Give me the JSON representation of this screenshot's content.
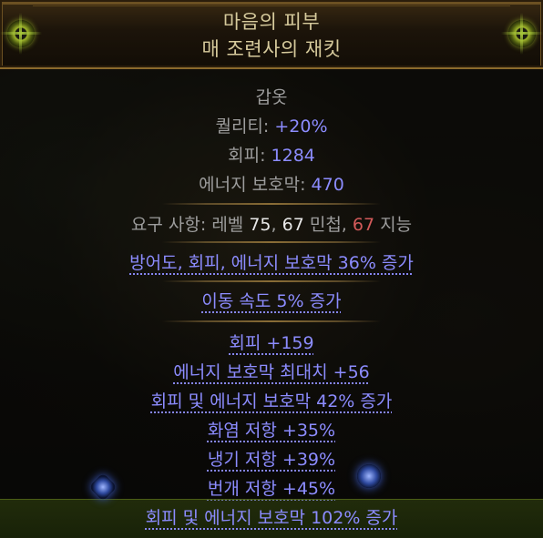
{
  "item": {
    "name": "마음의 피부",
    "base": "매 조련사의 재킷",
    "item_class": "갑옷",
    "properties": [
      {
        "label": "퀄리티: ",
        "value": "+20%"
      },
      {
        "label": "회피: ",
        "value": "1284"
      },
      {
        "label": "에너지 보호막: ",
        "value": "470"
      }
    ],
    "requirements": {
      "prefix": "요구 사항: ",
      "level_label": "레벨",
      "level": " 75",
      "sep1": ", ",
      "dex": "67",
      "dex_label": " 민첩",
      "sep2": ", ",
      "int": "67",
      "int_label": " 지능"
    },
    "implicit": "방어도, 회피, 에너지 보호막 36% 증가",
    "enchant": "이동 속도 5% 증가",
    "explicit_mods": [
      "회피 +159",
      "에너지 보호막 최대치 +56",
      "회피 및 에너지 보호막 42% 증가",
      "화염 저항 +35%",
      "냉기 저항 +39%",
      "번개 저항 +45%",
      "회피 및 에너지 보호막 102% 증가"
    ]
  },
  "colors": {
    "title": "#d6ca9c",
    "magic_mod": "#8c8cff",
    "label": "#9d9d9d",
    "value": "#e8e8e8",
    "unmet_requirement": "#d35a5a"
  }
}
